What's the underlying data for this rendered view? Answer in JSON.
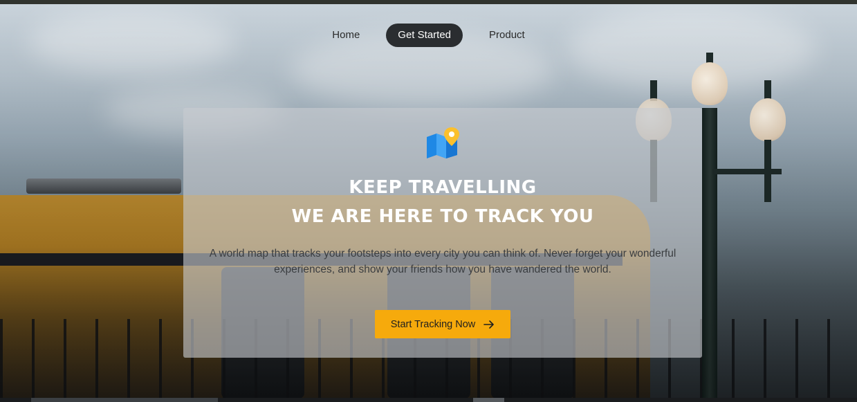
{
  "nav": {
    "items": [
      {
        "label": "Home",
        "active": false
      },
      {
        "label": "Get Started",
        "active": true
      },
      {
        "label": "Product",
        "active": false
      }
    ]
  },
  "hero": {
    "icon": "map-pin-icon",
    "headline_line1": "KEEP TRAVELLING",
    "headline_line2": "WE ARE HERE TO TRACK YOU",
    "description": "A world map that tracks your footsteps into every city you can think of. Never forget your wonderful experiences, and show your friends how you have wandered the world.",
    "cta_label": "Start Tracking Now",
    "cta_icon": "arrow-right-icon"
  },
  "colors": {
    "accent": "#f6aa0c",
    "nav_active_bg": "#2a2d30",
    "map_blue": "#1e88e5",
    "pin_yellow": "#fbc02d"
  }
}
